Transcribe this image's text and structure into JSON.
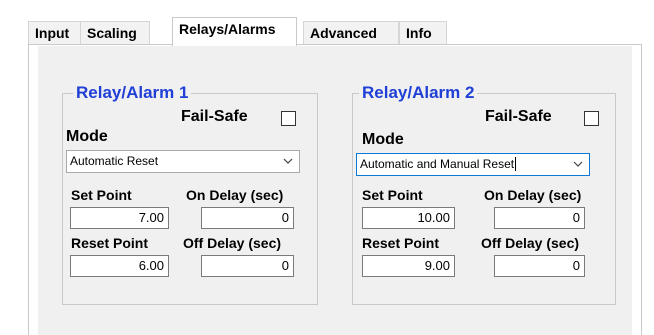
{
  "tabs": [
    {
      "label": "Input",
      "active": false
    },
    {
      "label": "Scaling",
      "active": false
    },
    {
      "label": "Relays/Alarms",
      "active": true
    },
    {
      "label": "Advanced",
      "active": false
    },
    {
      "label": "Info",
      "active": false
    }
  ],
  "relay1": {
    "title": "Relay/Alarm 1",
    "fail_safe_label": "Fail-Safe",
    "fail_safe_checked": false,
    "mode_label": "Mode",
    "mode_value": "Automatic Reset",
    "set_point_label": "Set Point",
    "set_point_value": "7.00",
    "on_delay_label": "On Delay (sec)",
    "on_delay_value": "0",
    "reset_point_label": "Reset Point",
    "reset_point_value": "6.00",
    "off_delay_label": "Off Delay (sec)",
    "off_delay_value": "0"
  },
  "relay2": {
    "title": "Relay/Alarm 2",
    "fail_safe_label": "Fail-Safe",
    "fail_safe_checked": false,
    "mode_label": "Mode",
    "mode_value": "Automatic and Manual Reset",
    "set_point_label": "Set Point",
    "set_point_value": "10.00",
    "on_delay_label": "On Delay (sec)",
    "on_delay_value": "0",
    "reset_point_label": "Reset Point",
    "reset_point_value": "9.00",
    "off_delay_label": "Off Delay (sec)",
    "off_delay_value": "0"
  },
  "colors": {
    "legend_blue": "#1f3fd6",
    "focus_border": "#0a78d7",
    "tab_page_background": "#f0f0f0"
  }
}
